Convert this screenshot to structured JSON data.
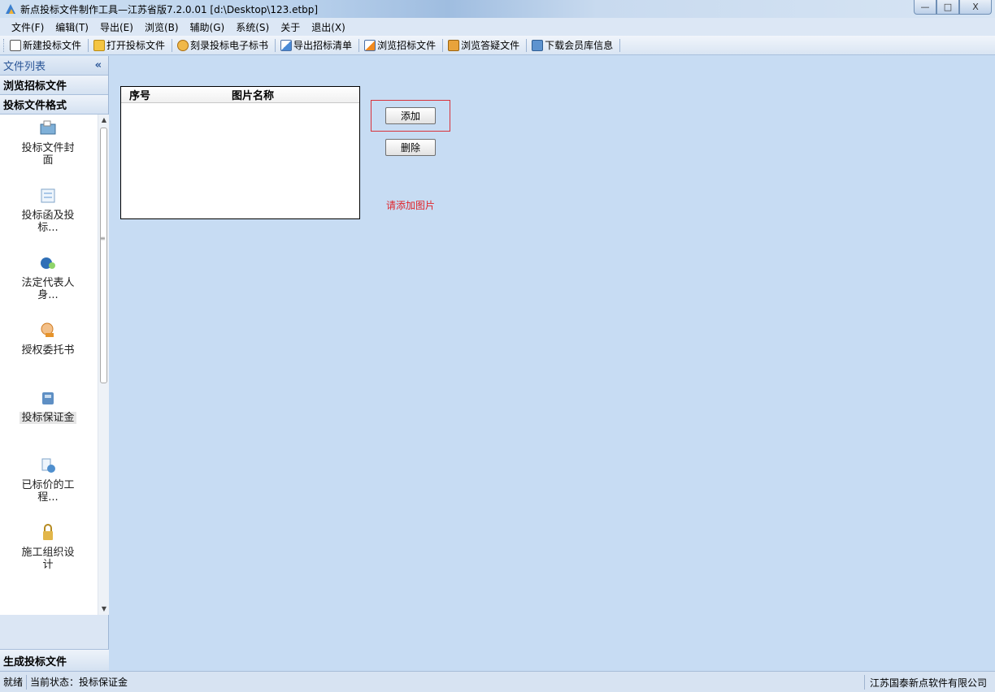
{
  "window": {
    "title": "新点投标文件制作工具—江苏省版7.2.0.01   [d:\\Desktop\\123.etbp]",
    "minimize": "—",
    "maximize": "□",
    "close": "X"
  },
  "menu": [
    "文件(F)",
    "编辑(T)",
    "导出(E)",
    "浏览(B)",
    "辅助(G)",
    "系统(S)",
    "关于",
    "退出(X)"
  ],
  "toolbar": [
    {
      "label": "新建投标文件",
      "icon": "new-document-icon"
    },
    {
      "label": "打开投标文件",
      "icon": "open-folder-icon"
    },
    {
      "label": "刻录投标电子标书",
      "icon": "burn-disc-icon"
    },
    {
      "label": "导出招标清单",
      "icon": "export-list-icon"
    },
    {
      "label": "浏览招标文件",
      "icon": "view-tender-icon"
    },
    {
      "label": "浏览答疑文件",
      "icon": "view-qa-icon"
    },
    {
      "label": "下载会员库信息",
      "icon": "download-member-icon"
    }
  ],
  "sidebar": {
    "header": "文件列表",
    "collapse": "«",
    "sections": {
      "browse": "浏览招标文件",
      "format": "投标文件格式",
      "generate": "生成投标文件"
    },
    "items": [
      {
        "label": "投标文件封面",
        "icon": "cover-icon",
        "color": "#7fb0d8"
      },
      {
        "label": "投标函及投标...",
        "icon": "letter-icon",
        "color": "#a9c7e8"
      },
      {
        "label": "法定代表人身...",
        "icon": "legal-rep-icon",
        "color": "#2f6fb6"
      },
      {
        "label": "授权委托书",
        "icon": "authorization-icon",
        "color": "#e6942c"
      },
      {
        "label": "投标保证金",
        "icon": "deposit-icon",
        "color": "#5e8fc4"
      },
      {
        "label": "已标价的工程...",
        "icon": "priced-project-icon",
        "color": "#4f8fce"
      },
      {
        "label": "施工组织设计",
        "icon": "construction-design-icon",
        "color": "#e2b64a"
      }
    ],
    "active_index": 4
  },
  "grid": {
    "columns": [
      "序号",
      "图片名称"
    ],
    "rows": []
  },
  "actions": {
    "add": "添加",
    "delete": "删除"
  },
  "hint": "请添加图片",
  "status": {
    "ready": "就绪",
    "current": "当前状态：投标保证金",
    "company": "江苏国泰新点软件有限公司"
  }
}
